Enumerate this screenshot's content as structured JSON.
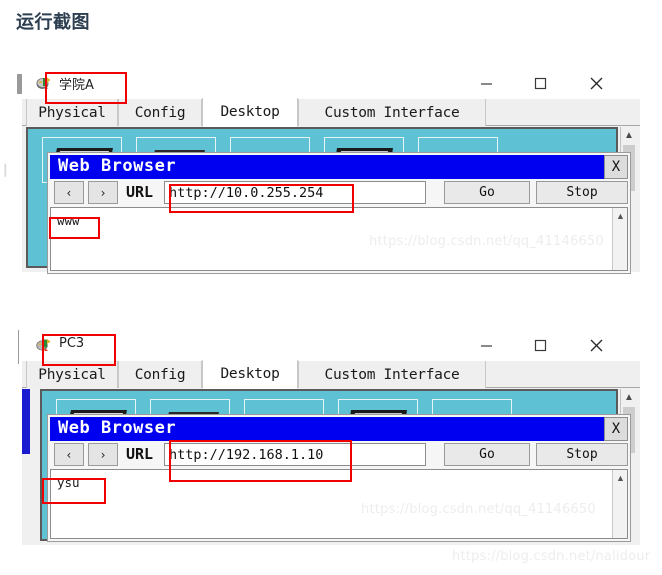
{
  "page": {
    "heading": "运行截图",
    "bg_color": "#ffffff"
  },
  "colors": {
    "annotation_red": "#f00000",
    "browser_titlebar_blue": "#0000f0",
    "desktop_cyan": "#5fc2d4",
    "window_chrome": "#f0f0f0"
  },
  "windows": [
    {
      "id": "window-xueyuana",
      "title": "学院A",
      "title_icon": "router-device-icon",
      "controls": {
        "minimize": "minimize-icon",
        "maximize": "maximize-icon",
        "close": "close-icon"
      },
      "tabs": [
        {
          "label": "Physical",
          "active": false
        },
        {
          "label": "Config",
          "active": false
        },
        {
          "label": "Desktop",
          "active": true
        },
        {
          "label": "Custom Interface",
          "active": false
        }
      ],
      "desktop": {
        "icon_count": 5,
        "icons": [
          {
            "name": "desktop-icon-1"
          },
          {
            "name": "desktop-icon-2"
          },
          {
            "name": "desktop-icon-3"
          },
          {
            "name": "desktop-icon-4"
          },
          {
            "name": "desktop-icon-5"
          }
        ]
      },
      "browser": {
        "title": "Web Browser",
        "close_label": "X",
        "back_label": "‹",
        "forward_label": "›",
        "url_label": "URL",
        "url_value": "http://10.0.255.254",
        "go_label": "Go",
        "stop_label": "Stop",
        "page_text": "www",
        "scroll_up_label": "ⱏ"
      },
      "watermark": "https://blog.csdn.net/qq_41146650"
    },
    {
      "id": "window-pc3",
      "title": "PC3",
      "title_icon": "pc-device-icon",
      "controls": {
        "minimize": "minimize-icon",
        "maximize": "maximize-icon",
        "close": "close-icon"
      },
      "tabs": [
        {
          "label": "Physical",
          "active": false
        },
        {
          "label": "Config",
          "active": false
        },
        {
          "label": "Desktop",
          "active": true
        },
        {
          "label": "Custom Interface",
          "active": false
        }
      ],
      "desktop": {
        "icon_count": 5,
        "icons": [
          {
            "name": "desktop-icon-1"
          },
          {
            "name": "desktop-icon-2"
          },
          {
            "name": "desktop-icon-3"
          },
          {
            "name": "desktop-icon-4"
          },
          {
            "name": "desktop-icon-5"
          }
        ]
      },
      "browser": {
        "title": "Web Browser",
        "close_label": "X",
        "back_label": "‹",
        "forward_label": "›",
        "url_label": "URL",
        "url_value": "http://192.168.1.10",
        "go_label": "Go",
        "stop_label": "Stop",
        "page_text": "ysu",
        "scroll_up_label": "ⱏ"
      },
      "watermark": "https://blog.csdn.net/qq_41146650"
    }
  ],
  "footer_watermark": "https://blog.csdn.net/nalidour"
}
